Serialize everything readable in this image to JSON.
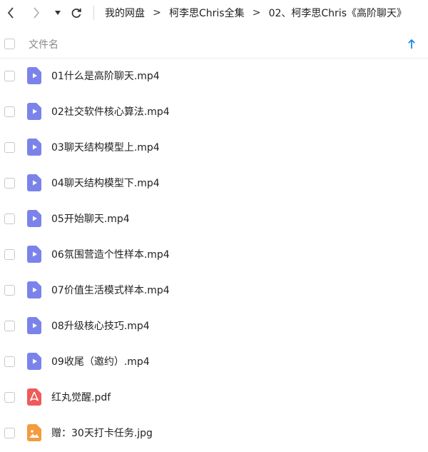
{
  "toolbar": {
    "back_icon": "chevron-left-icon",
    "forward_icon": "chevron-right-icon",
    "history_icon": "caret-down-icon",
    "refresh_icon": "refresh-icon"
  },
  "breadcrumb": {
    "separator": ">",
    "items": [
      "我的网盘",
      "柯李思Chris全集",
      "02、柯李思Chris《高阶聊天》"
    ]
  },
  "list_header": {
    "name_column": "文件名",
    "sort_icon": "arrow-up-icon",
    "sort_color": "#1e88e5"
  },
  "colors": {
    "video": "#7b83eb",
    "pdf": "#ef5a5a",
    "image": "#f59b3c"
  },
  "files": [
    {
      "name": "01什么是高阶聊天.mp4",
      "type": "video"
    },
    {
      "name": "02社交软件核心算法.mp4",
      "type": "video"
    },
    {
      "name": "03聊天结构模型上.mp4",
      "type": "video"
    },
    {
      "name": "04聊天结构模型下.mp4",
      "type": "video"
    },
    {
      "name": "05开始聊天.mp4",
      "type": "video"
    },
    {
      "name": "06氛围营造个性样本.mp4",
      "type": "video"
    },
    {
      "name": "07价值生活模式样本.mp4",
      "type": "video"
    },
    {
      "name": "08升级核心技巧.mp4",
      "type": "video"
    },
    {
      "name": "09收尾（邀约）.mp4",
      "type": "video"
    },
    {
      "name": "红丸觉醒.pdf",
      "type": "pdf"
    },
    {
      "name": "赠：30天打卡任务.jpg",
      "type": "image"
    }
  ]
}
